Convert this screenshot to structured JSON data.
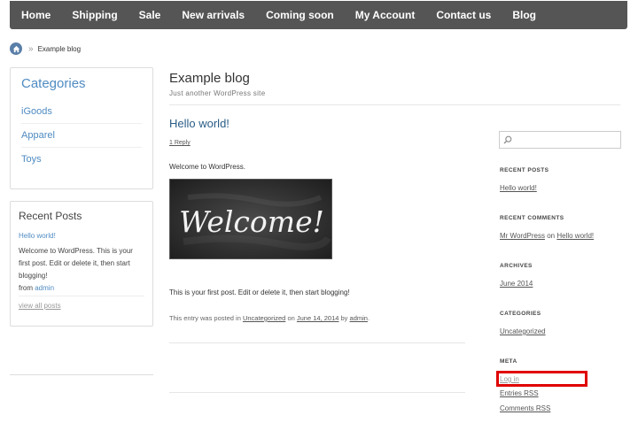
{
  "nav": [
    "Home",
    "Shipping",
    "Sale",
    "New arrivals",
    "Coming soon",
    "My Account",
    "Contact us",
    "Blog"
  ],
  "breadcrumb": {
    "separator": "»",
    "current": "Example blog"
  },
  "categories_widget": {
    "title": "Categories",
    "items": [
      "iGoods",
      "Apparel",
      "Toys"
    ]
  },
  "recent_widget": {
    "title": "Recent Posts",
    "post_link": "Hello world!",
    "excerpt": "Welcome to WordPress.   This is your first post. Edit or delete it, then start blogging!",
    "from_label": "from",
    "author": "admin",
    "view_all": "view all posts"
  },
  "site": {
    "title": "Example blog",
    "tagline": "Just another WordPress site"
  },
  "post": {
    "title": "Hello world!",
    "reply": "1 Reply",
    "intro": "Welcome to WordPress.",
    "image_text": "Welcome!",
    "body": "This is your first post. Edit or delete it, then start blogging!",
    "meta_prefix": "This entry was posted in",
    "category": "Uncategorized",
    "meta_on": "on",
    "date": "June 14, 2014",
    "meta_by": "by",
    "author": "admin"
  },
  "sidebar": {
    "search_placeholder": "",
    "recent_posts_heading": "RECENT POSTS",
    "recent_post": "Hello world!",
    "recent_comments_heading": "RECENT COMMENTS",
    "comment_author": "Mr WordPress",
    "comment_on": "on",
    "comment_post": "Hello world!",
    "archives_heading": "ARCHIVES",
    "archive": "June 2014",
    "categories_heading": "CATEGORIES",
    "category": "Uncategorized",
    "meta_heading": "META",
    "meta_links": [
      "Log in",
      "Entries RSS",
      "Comments RSS"
    ]
  },
  "colors": {
    "nav_bg": "#555555",
    "link": "#4f8bc2",
    "highlight": "#e00000"
  }
}
